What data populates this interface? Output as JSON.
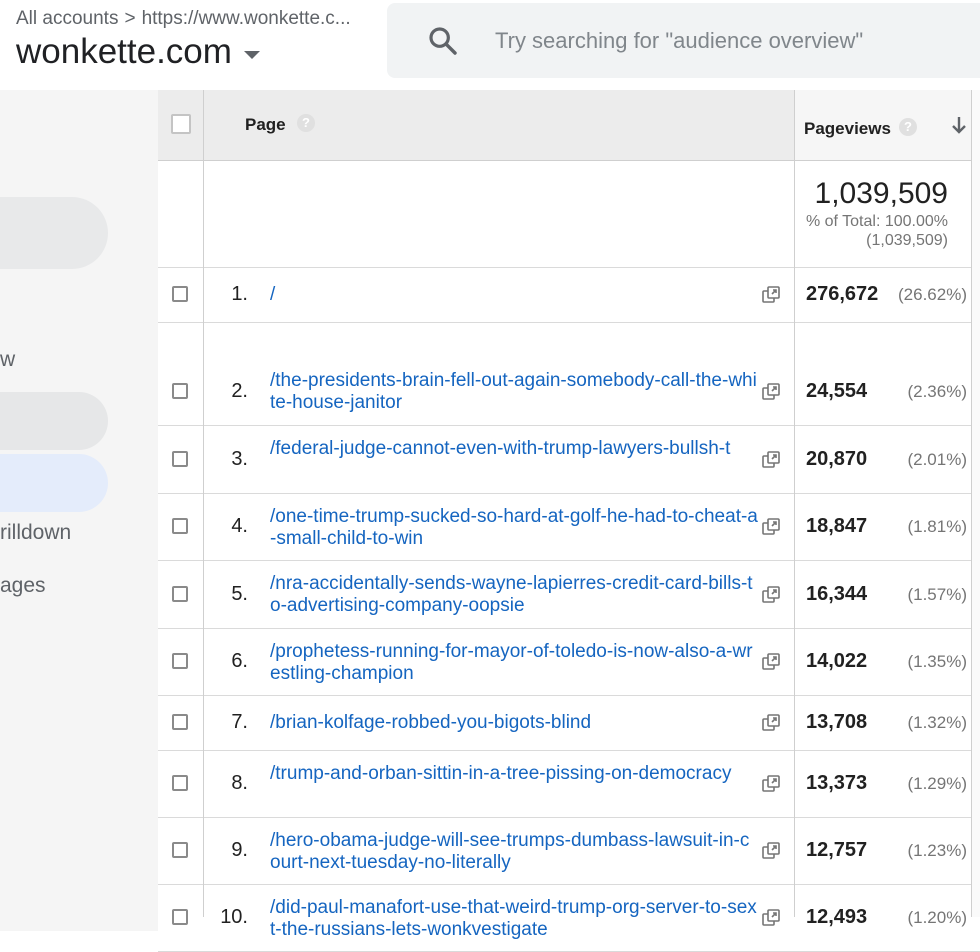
{
  "header": {
    "breadcrumb": {
      "root": "All accounts",
      "property": "https://www.wonkette.c..."
    },
    "account_name": "wonkette.com",
    "search_placeholder": "Try searching for \"audience overview\""
  },
  "sidebar": {
    "items": [
      {
        "label": "w"
      },
      {
        "label": "rilldown"
      },
      {
        "label": "ages"
      }
    ]
  },
  "table": {
    "columns": {
      "page": "Page",
      "pageviews": "Pageviews"
    },
    "help_glyph": "?",
    "totals": {
      "value": "1,039,509",
      "pct_label": "% of Total: 100.00%",
      "total_paren": "(1,039,509)"
    },
    "rows": [
      {
        "num": "1.",
        "page": "/",
        "pageviews": "276,672",
        "pct": "(26.62%)"
      },
      {
        "num": "2.",
        "page": "/the-presidents-brain-fell-out-again-somebody-call-the-white-house-janitor",
        "pageviews": "24,554",
        "pct": "(2.36%)"
      },
      {
        "num": "3.",
        "page": "/federal-judge-cannot-even-with-trump-lawyers-bullsh-t",
        "pageviews": "20,870",
        "pct": "(2.01%)"
      },
      {
        "num": "4.",
        "page": "/one-time-trump-sucked-so-hard-at-golf-he-had-to-cheat-a-small-child-to-win",
        "pageviews": "18,847",
        "pct": "(1.81%)"
      },
      {
        "num": "5.",
        "page": "/nra-accidentally-sends-wayne-lapierres-credit-card-bills-to-advertising-company-oopsie",
        "pageviews": "16,344",
        "pct": "(1.57%)"
      },
      {
        "num": "6.",
        "page": "/prophetess-running-for-mayor-of-toledo-is-now-also-a-wrestling-champion",
        "pageviews": "14,022",
        "pct": "(1.35%)"
      },
      {
        "num": "7.",
        "page": "/brian-kolfage-robbed-you-bigots-blind",
        "pageviews": "13,708",
        "pct": "(1.32%)"
      },
      {
        "num": "8.",
        "page": "/trump-and-orban-sittin-in-a-tree-pissing-on-democracy",
        "pageviews": "13,373",
        "pct": "(1.29%)"
      },
      {
        "num": "9.",
        "page": "/hero-obama-judge-will-see-trumps-dumbass-lawsuit-in-court-next-tuesday-no-literally",
        "pageviews": "12,757",
        "pct": "(1.23%)"
      },
      {
        "num": "10.",
        "page": "/did-paul-manafort-use-that-weird-trump-org-server-to-sext-the-russians-lets-wonkvestigate",
        "pageviews": "12,493",
        "pct": "(1.20%)"
      }
    ]
  },
  "colors": {
    "link": "#1565c0",
    "sidebar_bg": "#f5f5f5",
    "selected_nav": "#e4ecfb",
    "search_bg": "#f1f3f4"
  },
  "icons": [
    "search-icon",
    "chevron-down-icon",
    "help-icon",
    "sort-arrow-down-icon",
    "open-external-icon"
  ]
}
